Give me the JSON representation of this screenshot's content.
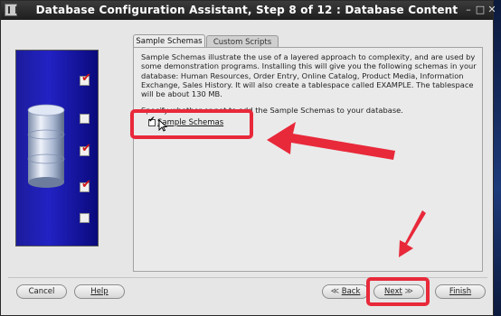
{
  "window": {
    "title": "Database Configuration Assistant, Step 8 of 12 : Database Content"
  },
  "tabs": [
    {
      "label": "Sample Schemas"
    },
    {
      "label": "Custom Scripts"
    }
  ],
  "content": {
    "description": "Sample Schemas illustrate the use of a layered approach to complexity, and are used by some demonstration programs. Installing this will give you the following schemas in your database: Human Resources, Order Entry, Online Catalog, Product Media, Information Exchange, Sales History. It will also create a tablespace called EXAMPLE. The tablespace will be about 130 MB.",
    "prompt": "Specify whether or not to add the Sample Schemas to your database.",
    "sample_schemas_checkbox": {
      "label": "Sample Schemas",
      "checked": true
    }
  },
  "buttons": {
    "cancel": "Cancel",
    "help": "Help",
    "back": "Back",
    "next": "Next",
    "finish": "Finish"
  },
  "colors": {
    "annotation": "#e8293a",
    "titlebar": "#2a2a2a",
    "side_panel": "#2020b8"
  }
}
